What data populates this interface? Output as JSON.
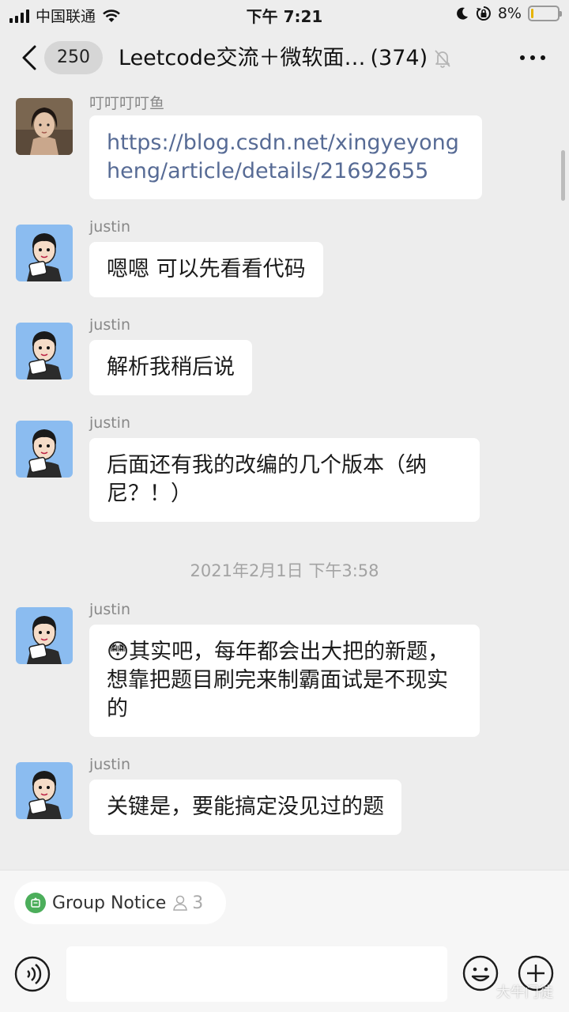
{
  "status_bar": {
    "carrier": "中国联通",
    "time": "下午 7:21",
    "battery": "8%",
    "battery_level": 0.08,
    "icons": [
      "signal-icon",
      "wifi-icon",
      "moon-icon",
      "orientation-lock-icon",
      "battery-icon"
    ]
  },
  "nav": {
    "back_icon": "chevron-left-icon",
    "unread_badge": "250",
    "title": "Leetcode交流＋微软面…",
    "member_count": "(374)",
    "mute_icon": "bell-off-icon",
    "more_icon": "more-icon"
  },
  "messages": [
    {
      "sender": "叮叮叮叮鱼",
      "text": "https://blog.csdn.net/xingyeyongheng/article/details/21692655",
      "type": "link"
    },
    {
      "sender": "justin",
      "text": "嗯嗯 可以先看看代码"
    },
    {
      "sender": "justin",
      "text": "解析我稍后说"
    },
    {
      "sender": "justin",
      "text": "后面还有我的改编的几个版本（纳尼？！）"
    },
    {
      "sender": "justin",
      "text": "其实吧，每年都会出大把的新题，想靠把题目刷完来制霸面试是不现实的",
      "emoji": "😳"
    },
    {
      "sender": "justin",
      "text": "关键是，要能搞定没见过的题"
    }
  ],
  "timestamp": "2021年2月1日 下午3:58",
  "bottom": {
    "group_notice_label": "Group Notice",
    "group_notice_count": "3",
    "input_placeholder": "",
    "watermark": "大牛门徒"
  },
  "colors": {
    "background": "#ededed",
    "bubble": "#ffffff",
    "link": "#576b95",
    "notice_green": "#4cae5b",
    "battery_low": "#e6b400"
  }
}
